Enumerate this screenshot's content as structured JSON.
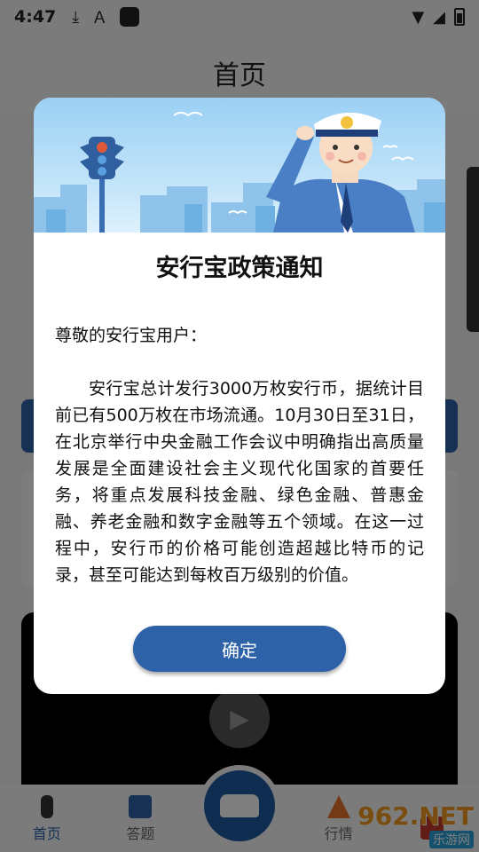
{
  "status_bar": {
    "time": "4:47"
  },
  "header": {
    "title": "首页"
  },
  "tabbar": {
    "items": [
      {
        "label": "首页",
        "icon": "traffic-light-icon",
        "active": true
      },
      {
        "label": "答题",
        "icon": "parking-icon",
        "active": false
      },
      {
        "label": "",
        "icon": "car-icon",
        "active": false
      },
      {
        "label": "行情",
        "icon": "traffic-cone-icon",
        "active": false
      }
    ]
  },
  "watermark": {
    "brand": "962.NET",
    "subtitle": "乐游网"
  },
  "dialog": {
    "title": "安行宝政策通知",
    "greeting": "尊敬的安行宝用户：",
    "body": "安行宝总计发行3000万枚安行币，据统计目前已有500万枚在市场流通。10月30日至31日，在北京举行中央金融工作会议中明确指出高质量发展是全面建设社会主义现代化国家的首要任务，将重点发展科技金融、绿色金融、普惠金融、养老金融和数字金融等五个领域。在这一过程中，安行币的价格可能创造超越比特币的记录，甚至可能达到每枚百万级别的价值。",
    "confirm_label": "确定"
  },
  "colors": {
    "accent": "#2d62a9",
    "overlay": "rgba(0,0,0,0.5)"
  }
}
